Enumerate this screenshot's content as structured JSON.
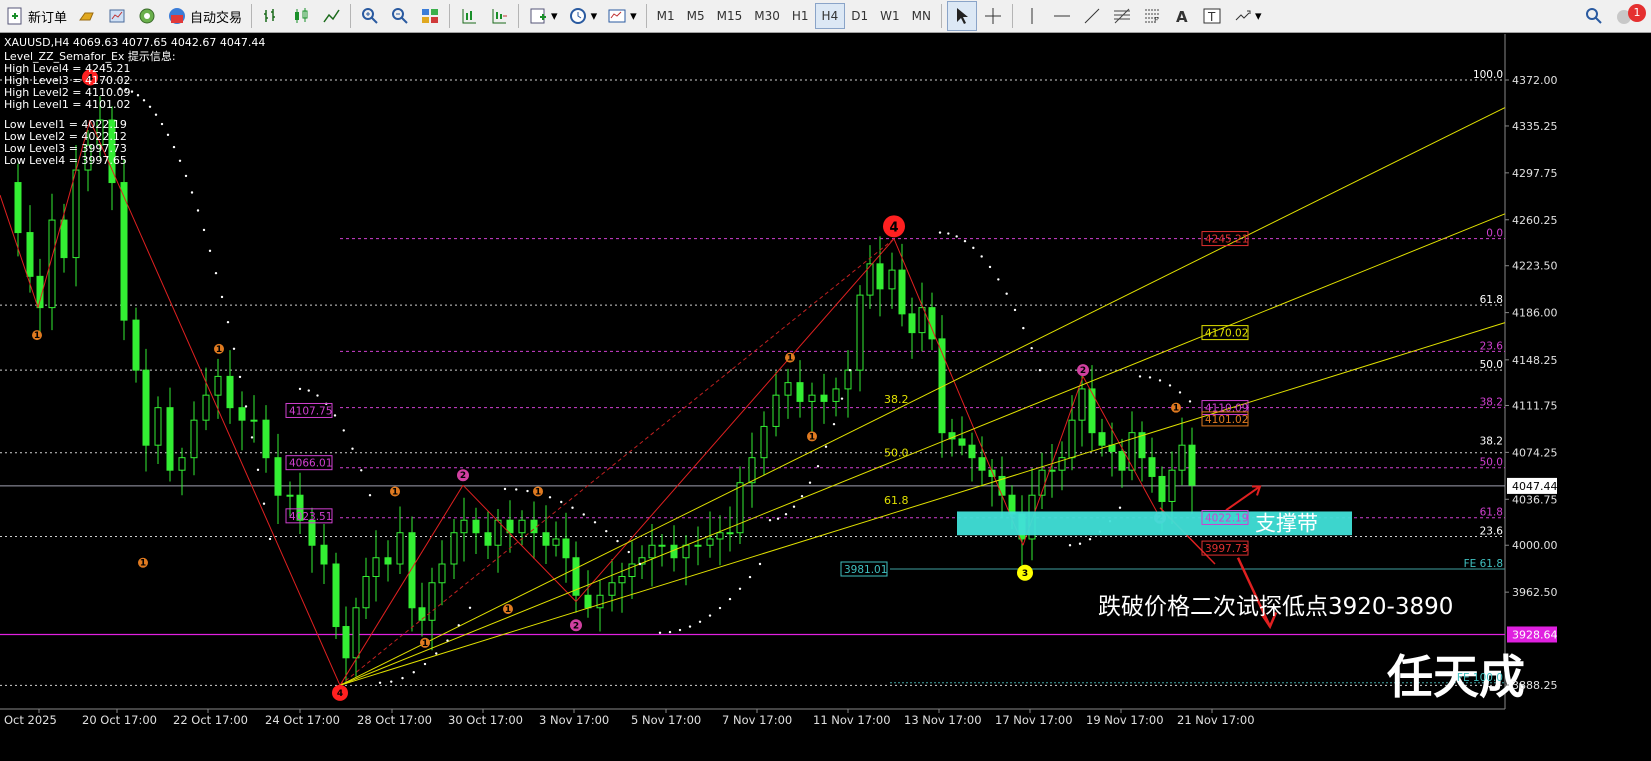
{
  "toolbar": {
    "new_order_label": "新订单",
    "auto_trading_label": "自动交易",
    "timeframes": [
      "M1",
      "M5",
      "M15",
      "M30",
      "H1",
      "H4",
      "D1",
      "W1",
      "MN"
    ],
    "active_timeframe": "H4",
    "notification_count": "1"
  },
  "chart": {
    "header": "XAUUSD,H4  4069.63 4077.65 4042.67 4047.44",
    "indicator_name": "Level_ZZ_Semafor_Ex 提示信息:",
    "high_levels": [
      "High Level4 = 4245.21",
      "High Level3 = 4170.02",
      "High Level2 = 4110.09",
      "High Level1 = 4101.02"
    ],
    "low_levels": [
      "Low Level1 = 4022.19",
      "Low Level2 = 4022.12",
      "Low Level3 = 3997.73",
      "Low Level4 = 3997.65"
    ],
    "price_axis": [
      "4372.00",
      "4335.25",
      "4297.75",
      "4260.25",
      "4223.50",
      "4186.00",
      "4148.25",
      "4111.75",
      "4074.25",
      "4036.75",
      "4000.00",
      "3962.50",
      "3925.00",
      "3888.25"
    ],
    "current_price": "4047.44",
    "support_price_tag": "3928.64",
    "time_axis": [
      "Oct 2025",
      "20 Oct 17:00",
      "22 Oct 17:00",
      "24 Oct 17:00",
      "28 Oct 17:00",
      "30 Oct 17:00",
      "3 Nov 17:00",
      "5 Nov 17:00",
      "7 Nov 17:00",
      "11 Nov 17:00",
      "13 Nov 17:00",
      "17 Nov 17:00",
      "19 Nov 17:00",
      "21 Nov 17:00"
    ],
    "fib_right_labels": [
      "100.0",
      "0.0",
      "61.8",
      "23.6",
      "50.0",
      "38.2",
      "38.2",
      "50.0",
      "61.8",
      "23.6",
      "FE 61.8",
      "FE 100.0"
    ],
    "fib_mid_labels": [
      "38.2",
      "50.0",
      "61.8"
    ],
    "price_boxes_left": [
      "4107.75",
      "4066.01",
      "4023.51"
    ],
    "price_boxes_right": [
      "4245.21",
      "4170.02",
      "4110.09",
      "4101.02",
      "4022.19",
      "3997.73"
    ],
    "fe_box": "3981.01",
    "support_zone_label": "支撑带",
    "annotation": "跌破价格二次试探低点3920-3890",
    "watermark": "任天成",
    "markers": {
      "m4": "4",
      "m3": "3",
      "m2": "2",
      "m1": "1"
    }
  }
}
